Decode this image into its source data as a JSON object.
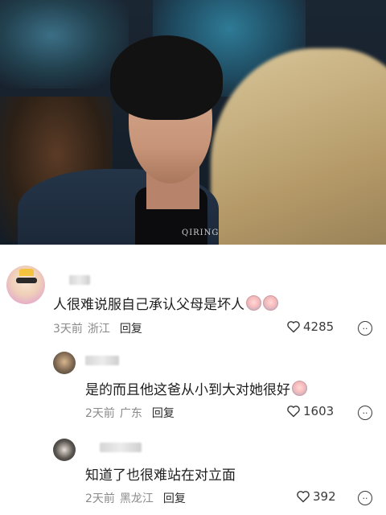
{
  "video": {
    "watermark": "QIRING"
  },
  "comments": [
    {
      "text": "人很难说服自己承认父母是坏人",
      "emoji": [
        "cry-laugh-emoji",
        "cry-laugh-emoji"
      ],
      "time": "3天前",
      "location": "浙江",
      "reply_label": "回复",
      "likes": "4285",
      "replies": [
        {
          "text": "是的而且他这爸从小到大对她很好",
          "emoji": [
            "cry-laugh-emoji"
          ],
          "time": "2天前",
          "location": "广东",
          "reply_label": "回复",
          "likes": "1603"
        },
        {
          "text": "知道了也很难站在对立面",
          "time": "2天前",
          "location": "黑龙江",
          "reply_label": "回复",
          "likes": "392"
        }
      ]
    }
  ],
  "icons": {
    "like": "heart-outline-icon",
    "more": "emoji-react-icon"
  }
}
